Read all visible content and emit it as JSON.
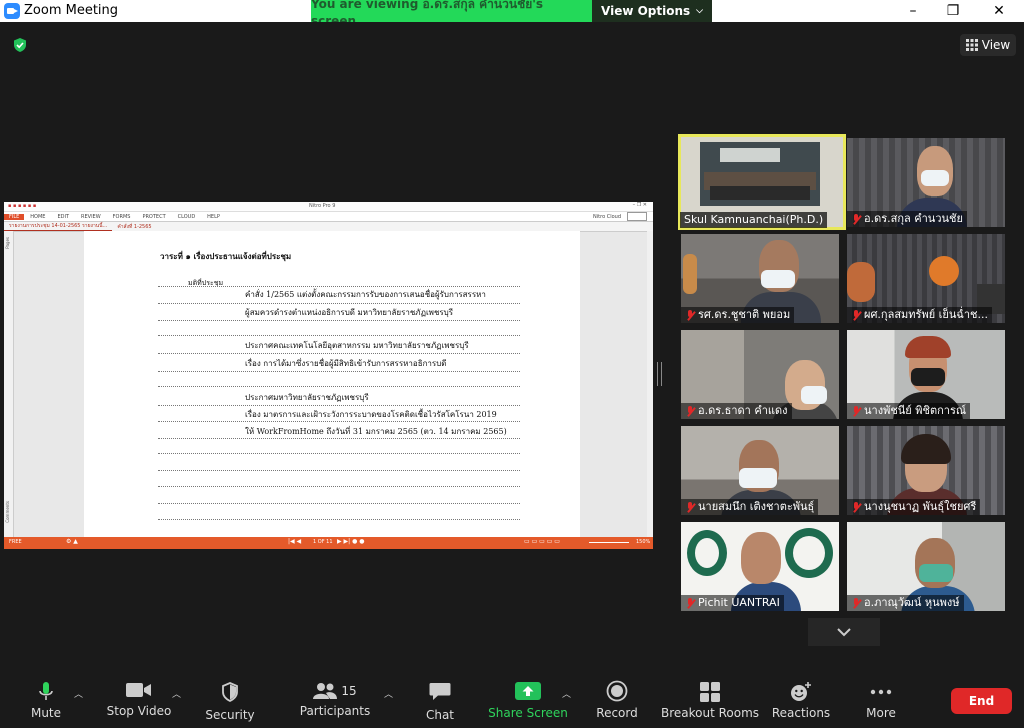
{
  "window": {
    "title": "Zoom Meeting",
    "share_banner": "You are viewing อ.ดร.สกุล คำนวนชัย's screen",
    "view_options": "View Options",
    "minimize": "–",
    "maximize": "❐",
    "close": "✕"
  },
  "meeting": {
    "view_label": "View"
  },
  "document": {
    "window_title": "Nitro Pro 9",
    "ribbon": [
      "FILE",
      "HOME",
      "EDIT",
      "REVIEW",
      "FORMS",
      "PROTECT",
      "CLOUD",
      "HELP"
    ],
    "account": "Nitro Cloud",
    "tabs": [
      "รายงานการประชุม 14-01-2565 รายงานนี้...",
      "คำสั่งที่ 1-2565"
    ],
    "sidebar_labels": {
      "top": "Pages",
      "bottom": "Comments"
    },
    "agenda": "วาระที่ ๑   เรื่องประธานแจ้งต่อที่ประชุม",
    "resolution_label": "มติที่ประชุม",
    "lines": [
      "คำสั่ง 1/2565 แต่งตั้งคณะกรรมการรับของการเสนอชื่อผู้รับการสรรหา",
      "ผู้สมควรดำรงตำแหน่งอธิการบดี มหาวิทยาลัยราชภัฏเพชรบุรี",
      "ประกาศคณะเทคโนโลยีอุตสาหกรรม มหาวิทยาลัยราชภัฏเพชรบุรี",
      "เรื่อง การได้มาซึ่งรายชื่อผู้มีสิทธิเข้ารับการสรรหาอธิการบดี",
      "ประกาศมหาวิทยาลัยราชภัฏเพชรบุรี",
      "เรื่อง มาตรการและเฝ้าระวังการระบาดของโรคติดเชื้อไวรัสโคโรนา 2019",
      "ให้ WorkFromHome ถึงวันที่ 31 มกราคม 2565 (ตว. 14 มกราคม 2565)"
    ],
    "status_left": "FREE",
    "page_indicator": "1 OF 11",
    "zoom": "150%"
  },
  "participants": [
    {
      "name": "Skul Kamnuanchai(Ph.D.)",
      "muted": false,
      "active": true
    },
    {
      "name": "อ.ดร.สกุล  คำนวนชัย",
      "muted": true
    },
    {
      "name": "รศ.ดร.ชูชาติ  พยอม",
      "muted": true
    },
    {
      "name": "ผศ.กุลสมทรัพย์  เย็นฉ่ำช...",
      "muted": true
    },
    {
      "name": "อ.ดร.ธาดา  คำแดง",
      "muted": true
    },
    {
      "name": "นางพัชนีย์  พิชิตการณ์",
      "muted": true
    },
    {
      "name": "นายสมนึก  เติงชาตะพันธุ์",
      "muted": true
    },
    {
      "name": "นางนุชนาฏ  พันธุ์ใชยศรี",
      "muted": true
    },
    {
      "name": "Pichit UANTRAI",
      "muted": true
    },
    {
      "name": "อ.ภาณุวัฒน์  หุนพงษ์",
      "muted": true
    }
  ],
  "toolbar": {
    "mute": "Mute",
    "stop_video": "Stop Video",
    "security": "Security",
    "participants": "Participants",
    "participants_count": "15",
    "chat": "Chat",
    "share_screen": "Share Screen",
    "record": "Record",
    "breakout_rooms": "Breakout Rooms",
    "reactions": "Reactions",
    "more": "More",
    "end": "End"
  },
  "colors": {
    "share_green": "#23d959",
    "end_red": "#e02828",
    "active_speaker": "#e8e85a",
    "doc_accent": "#e45a2a"
  }
}
